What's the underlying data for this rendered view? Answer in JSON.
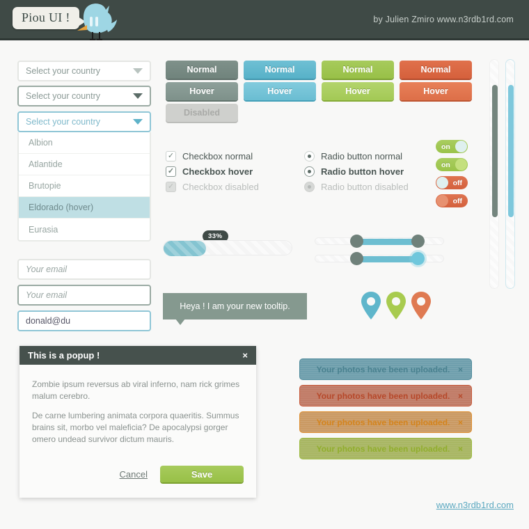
{
  "header": {
    "bubble_text": "Piou UI !",
    "credit": "by Julien Zmiro www.n3rdb1rd.com",
    "bg_color": "#3f4a46"
  },
  "selects": [
    {
      "label": "Select your country",
      "state": "normal"
    },
    {
      "label": "Select your country",
      "state": "hover"
    },
    {
      "label": "Select your country",
      "state": "focus"
    }
  ],
  "dropdown": {
    "options": [
      {
        "label": "Albion",
        "selected": false
      },
      {
        "label": "Atlantide",
        "selected": false
      },
      {
        "label": "Brutopie",
        "selected": false
      },
      {
        "label": "Eldorado (hover)",
        "selected": true
      },
      {
        "label": "Eurasia",
        "selected": false
      }
    ]
  },
  "inputs": [
    {
      "value": "Your email",
      "is_placeholder": true,
      "state": "normal"
    },
    {
      "value": "Your email",
      "is_placeholder": true,
      "state": "hover"
    },
    {
      "value": "donald@du",
      "is_placeholder": false,
      "state": "focus"
    }
  ],
  "buttons": {
    "normal_label": "Normal",
    "hover_label": "Hover",
    "disabled_label": "Disabled",
    "colors": {
      "grey": "#7f918a",
      "blue": "#6fc0d4",
      "green": "#a7cb5c",
      "red": "#e0714c",
      "disabled": "#cfd0cd"
    }
  },
  "checkboxes": [
    {
      "label": "Checkbox normal",
      "state": "normal",
      "checked": true
    },
    {
      "label": "Checkbox hover",
      "state": "hover",
      "checked": true
    },
    {
      "label": "Checkbox disabled",
      "state": "disabled",
      "checked": true
    }
  ],
  "radios": [
    {
      "label": "Radio button normal",
      "state": "normal",
      "checked": true
    },
    {
      "label": "Radio button hover",
      "state": "hover",
      "checked": true
    },
    {
      "label": "Radio button disabled",
      "state": "disabled",
      "checked": true
    }
  ],
  "toggles": [
    {
      "label": "on",
      "state": "normal",
      "on": true
    },
    {
      "label": "on",
      "state": "hover",
      "on": true
    },
    {
      "label": "off",
      "state": "normal",
      "on": false
    },
    {
      "label": "off",
      "state": "hover",
      "on": false
    }
  ],
  "progress": {
    "percent_label": "33%",
    "percent_value": 33,
    "fill_color": "#84c4d1"
  },
  "sliders": [
    {
      "left_handle": "dark",
      "right_handle": "dark"
    },
    {
      "left_handle": "dark",
      "right_handle": "cyan"
    }
  ],
  "tooltip": {
    "text": "Heya ! I am your new tooltip.",
    "color": "#85998f"
  },
  "pins": [
    {
      "color": "#5fb6cb"
    },
    {
      "color": "#a8cb4f"
    },
    {
      "color": "#df7a52"
    }
  ],
  "popup": {
    "title": "This is a popup !",
    "close_icon": "×",
    "paragraphs": [
      "Zombie ipsum reversus ab viral inferno, nam rick grimes malum cerebro.",
      "De carne lumbering animata corpora quaeritis. Summus brains sit, morbo vel maleficia? De apocalypsi gorger omero undead survivor dictum mauris."
    ],
    "cancel_label": "Cancel",
    "save_label": "Save"
  },
  "alerts": [
    {
      "message": "Your photos have been uploaded.",
      "close_icon": "×",
      "variant": "blue"
    },
    {
      "message": "Your photos have been uploaded.",
      "close_icon": "×",
      "variant": "red"
    },
    {
      "message": "Your photos have been uploaded.",
      "close_icon": "×",
      "variant": "orange"
    },
    {
      "message": "Your photos have been uploaded.",
      "close_icon": "×",
      "variant": "green"
    }
  ],
  "scrollbars": [
    {
      "thumb_color": "#74857e",
      "variant": "grey"
    },
    {
      "thumb_color": "#7ec8dc",
      "variant": "blue"
    }
  ],
  "footer": {
    "link": "www.n3rdb1rd.com",
    "color": "#5ba8c0"
  }
}
